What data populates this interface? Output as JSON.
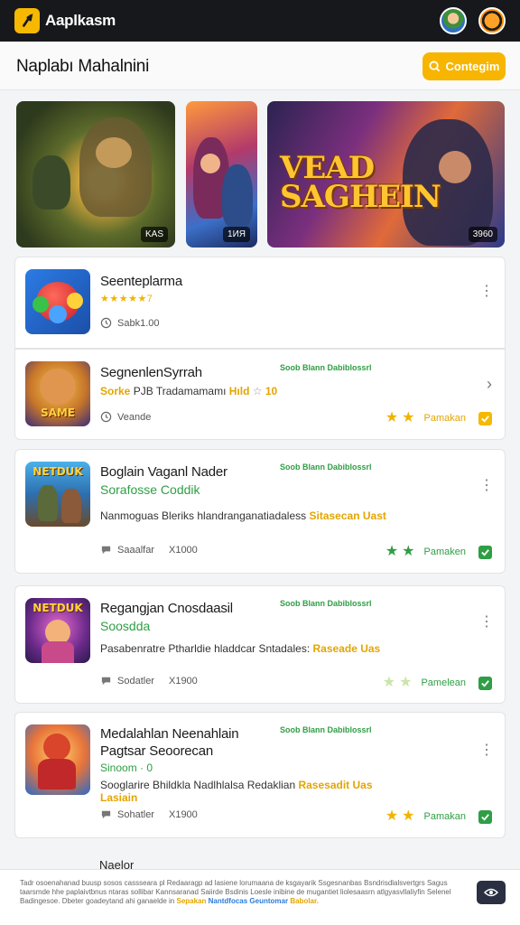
{
  "app": {
    "name": "Aaplkasm"
  },
  "header": {
    "title": "Naplabı Mahalnini",
    "cta_label": "Contegim"
  },
  "banners": [
    {
      "tag": "KAS"
    },
    {
      "tag": "1ИЯ"
    },
    {
      "tag": "3960",
      "title": "VEAD SAGHEIN"
    }
  ],
  "cards": [
    {
      "title": "Seenteplarma",
      "stars": "★★★★★7",
      "meta": "Sabk1.00"
    },
    {
      "title": "SegnenlenSyrrah",
      "tag": "Soob Blann Dabiblossrl",
      "desc_prefix": "Sorke",
      "desc_mid": "PJB Tradamamamı",
      "desc_hl": "Hıld",
      "desc_end": "10",
      "meta": "Veande",
      "rating_label": "Pamakan"
    },
    {
      "title": "Boglain Vaganl Nader",
      "subtitle": "Sorafosse Coddik",
      "tag": "Soob Blann Dabiblossrl",
      "desc_text": "Nanmoguas Bleriks hlandranganatiadaless",
      "desc_hl": "Sitasecan Uast",
      "meta": "Saaalfar",
      "count": "X1000",
      "rating_label": "Pamaken"
    },
    {
      "title": "Regangjan Cnosdaasil",
      "subtitle": "Soosdda",
      "tag": "Soob Blann Dabiblossrl",
      "desc_text": "Pasabenratre Ptharldie hladdcar Sntadales:",
      "desc_hl": "Raseade Uas",
      "meta": "Sodatler",
      "count": "X1900",
      "rating_label": "Pamelean"
    },
    {
      "title": "Medalahlan Neenahlain",
      "title2": "Pagtsar Seoorecan",
      "tag": "Soob Blann Dabiblossrl",
      "line3": "Sinoom · 0",
      "desc_text": "Sooglarire Bhildkla Nadlhlalsa Redaklian",
      "desc_hl": "Rasesadit Uas",
      "desc_tail": "Lasiain",
      "meta": "Sohatler",
      "count": "X1900",
      "rating_label": "Pamakan"
    }
  ],
  "footer_cut": "Naelor",
  "cookie": {
    "text": "Tadr osoenahanad buusp sosos cassseara pl Redaaragp ad lasiene lorumaana de ksgayarik Ssgesnanbas Bsndrisdlalsvertgrs Sagus taarsmde hhe paplaivtbnus ntaras sollibar Kannsaranad Saiirde Bsdinis Loesle inibine de mugantiet liolesaasrn atlgyasvllaliyfin Selenel Badingesoe. Dbeter goadeytand ahi ganaelde in",
    "link1": "Sepakan",
    "link2": "Nantdfocas Geuntomar",
    "link3": "Babolar."
  }
}
